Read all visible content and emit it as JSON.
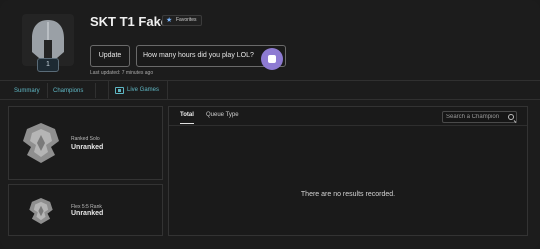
{
  "profile": {
    "summoner_name": "SKT T1 Faker",
    "favorites_label": "Favorites",
    "level": "1",
    "update_label": "Update",
    "hours_question": "How many hours did you play LOL?",
    "last_updated": "Last updated: 7 minutes ago",
    "icons": {
      "avatar": "helmet-icon",
      "favorite": "star-icon",
      "hours": "clock-icon"
    }
  },
  "tabs": {
    "summary": "Summary",
    "champions": "Champions",
    "live_games": "Live Games"
  },
  "ranks": {
    "solo": {
      "type": "Ranked Solo",
      "tier": "Unranked"
    },
    "flex": {
      "type": "Flex 5:5 Rank",
      "tier": "Unranked"
    }
  },
  "matches": {
    "tab_total": "Total",
    "tab_queue": "Queue Type",
    "search_placeholder": "Search a Champion",
    "empty_message": "There are no results recorded."
  },
  "colors": {
    "background": "#1c1c1c",
    "accent": "#5fb7c4",
    "purple": "#8e7bd2"
  }
}
